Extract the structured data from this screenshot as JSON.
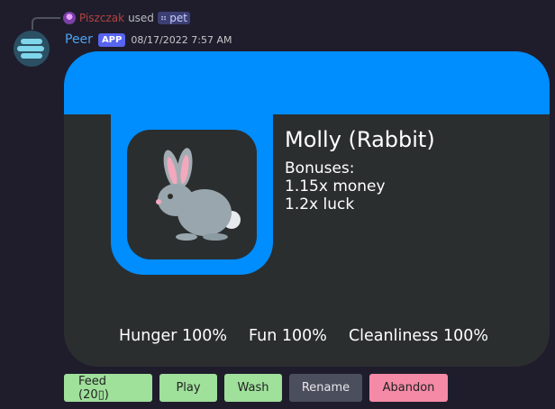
{
  "reply": {
    "username": "Piszczak",
    "used_text": "used",
    "command": "pet"
  },
  "message": {
    "author": "Peer",
    "tag": "APP",
    "timestamp": "08/17/2022 7:57 AM"
  },
  "pet": {
    "name": "Molly (Rabbit)",
    "bonuses_label": "Bonuses:",
    "bonuses": [
      "1.15x money",
      "1.2x luck"
    ],
    "stats": [
      {
        "label": "Hunger",
        "value": "100%"
      },
      {
        "label": "Fun",
        "value": "100%"
      },
      {
        "label": "Cleanliness",
        "value": "100%"
      }
    ]
  },
  "buttons": {
    "feed": "Feed (20▯)",
    "play": "Play",
    "wash": "Wash",
    "rename": "Rename",
    "abandon": "Abandon"
  },
  "colors": {
    "card_accent": "#008dfd",
    "card_bg": "#2a2e2f",
    "green_button": "#9fe09b",
    "grey_button": "#4b4e5c",
    "red_button": "#f48aa6"
  }
}
